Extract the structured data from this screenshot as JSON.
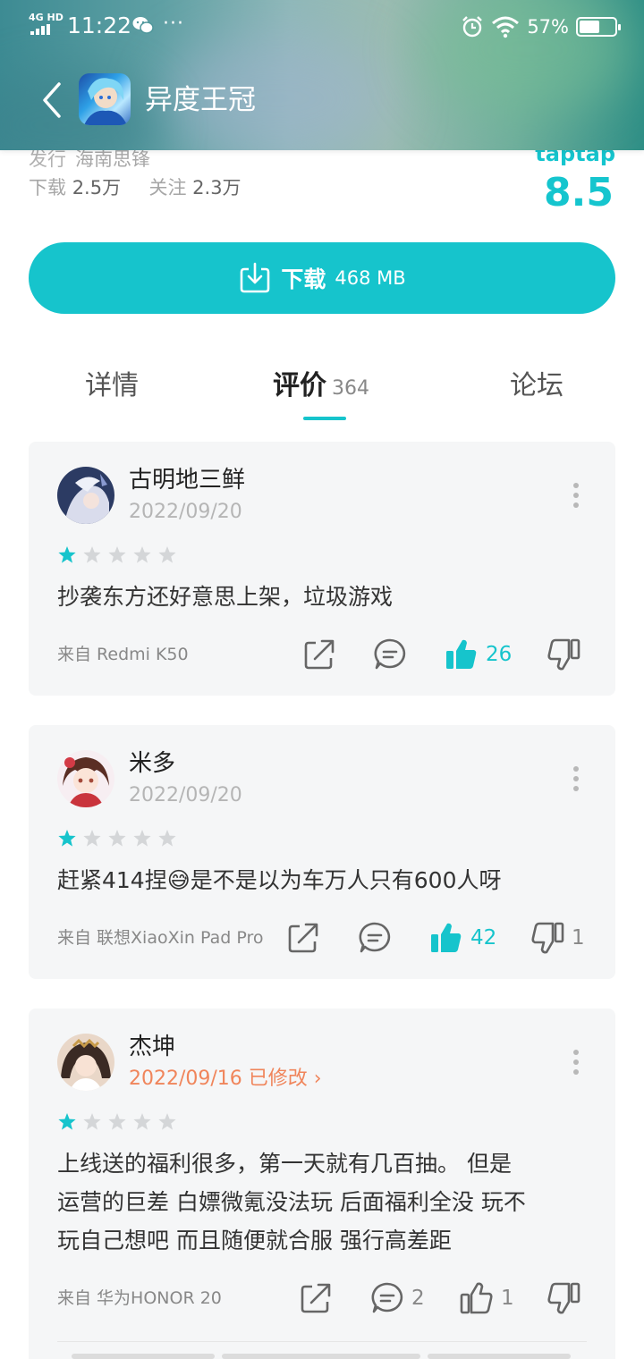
{
  "status_bar": {
    "network": "4G HD",
    "time": "11:22",
    "battery": "57%"
  },
  "header": {
    "title": "异度王冠"
  },
  "info": {
    "publisher_label": "发行",
    "publisher": "海南思锋",
    "downloads_label": "下载",
    "downloads": "2.5万",
    "follows_label": "关注",
    "follows": "2.3万",
    "rating_source": "taptap",
    "score": "8.5"
  },
  "download": {
    "label": "下载",
    "size": "468 MB"
  },
  "tabs": {
    "detail": "详情",
    "reviews": "评价",
    "reviews_count": "364",
    "forum": "论坛"
  },
  "reviews": [
    {
      "user": "古明地三鲜",
      "date": "2022/09/20",
      "stars": 1,
      "content": "抄袭东方还好意思上架，垃圾游戏",
      "device": "来自 Redmi K50",
      "likes": "26",
      "comments": "",
      "dislikes": ""
    },
    {
      "user": "米多",
      "date": "2022/09/20",
      "stars": 1,
      "content": "赶紧414捏😅是不是以为车万人只有600人呀",
      "device": "来自 联想XiaoXin Pad Pro",
      "likes": "42",
      "comments": "",
      "dislikes": "1"
    },
    {
      "user": "杰坤",
      "date": "2022/09/16 已修改 ›",
      "stars": 1,
      "content_lines": [
        "上线送的福利很多，第一天就有几百抽。 但是",
        "运营的巨差 白嫖微氪没法玩 后面福利全没 玩不",
        "玩自己想吧 而且随便就合服 强行高差距"
      ],
      "device": "来自 华为HONOR 20",
      "likes": "1",
      "comments": "2",
      "dislikes": ""
    }
  ],
  "colors": {
    "accent": "#16c4cc",
    "modified": "#f0855b"
  }
}
